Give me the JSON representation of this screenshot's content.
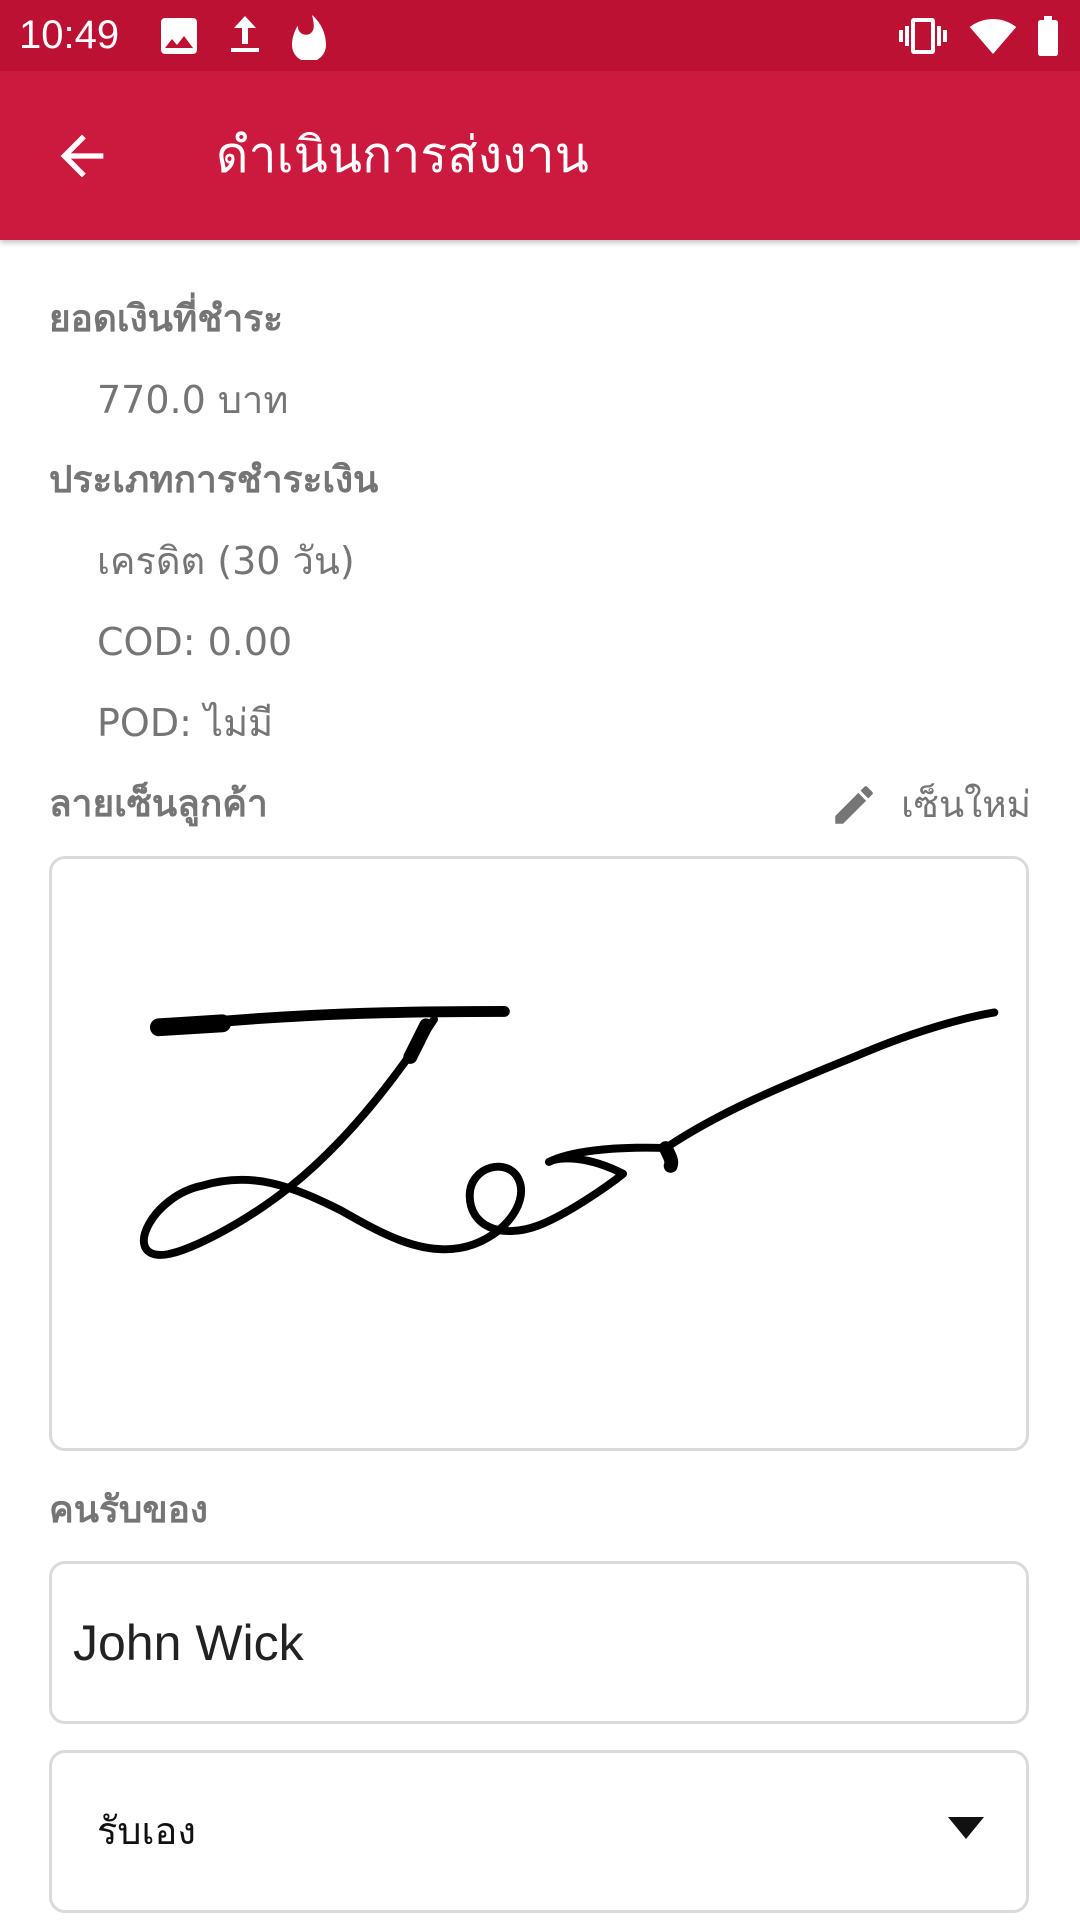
{
  "status_bar": {
    "time": "10:49",
    "left_icons": [
      "image-icon",
      "upload-icon",
      "fire-icon"
    ],
    "right_icons": [
      "vibrate-icon",
      "wifi-icon",
      "battery-icon"
    ]
  },
  "app_bar": {
    "title": "ดำเนินการส่งงาน",
    "back_icon": "arrow-back-icon"
  },
  "payment": {
    "amount_label": "ยอดเงินที่ชำระ",
    "amount_value": "770.0  บาท",
    "type_label": "ประเภทการชำระเงิน",
    "type_value": "เครดิต (30 วัน)",
    "cod": "COD: 0.00",
    "pod": "POD: ไม่มี"
  },
  "signature": {
    "label": "ลายเซ็นลูกค้า",
    "resign_label": "เซ็นใหม่",
    "resign_icon": "pencil-icon"
  },
  "receiver": {
    "label": "คนรับของ",
    "name_value": "John Wick",
    "relation_selected": "รับเอง"
  },
  "colors": {
    "status_bar": "#bd1133",
    "app_bar": "#cc1a3f",
    "label_gray": "#757575",
    "border_gray": "#dadada"
  }
}
